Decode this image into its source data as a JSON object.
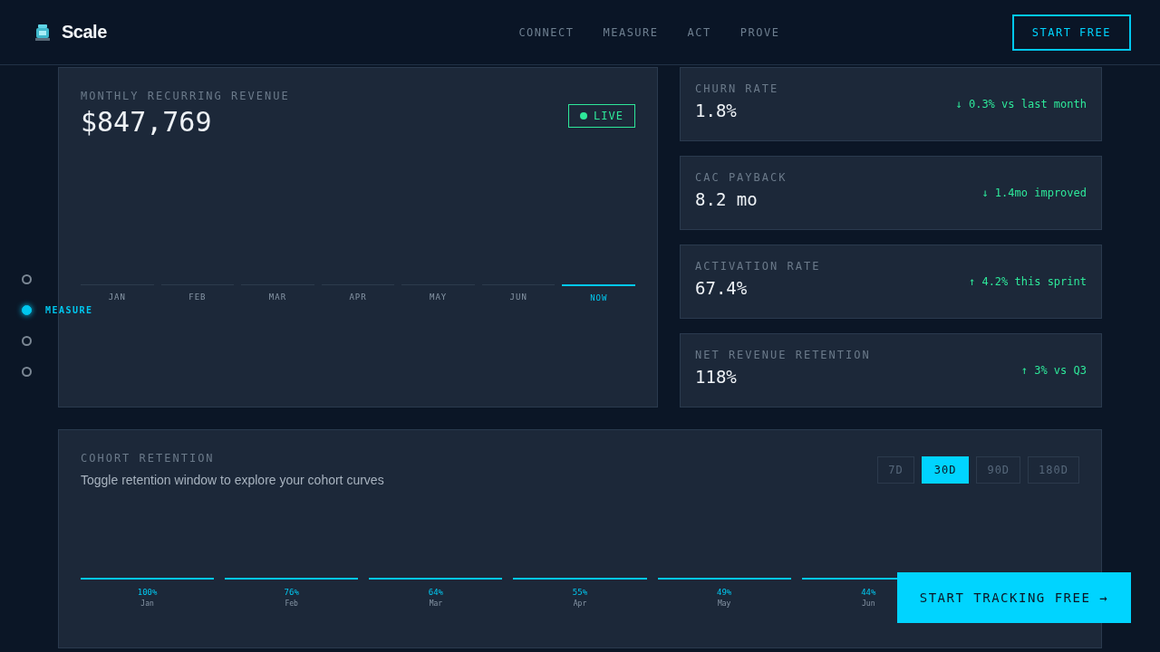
{
  "header": {
    "brand": "Scale",
    "nav": [
      {
        "label": "CONNECT",
        "selected": false
      },
      {
        "label": "MEASURE",
        "selected": false
      },
      {
        "label": "ACT",
        "selected": false
      },
      {
        "label": "PROVE",
        "selected": false
      }
    ],
    "cta": "START FREE"
  },
  "side_nav": [
    {
      "selected": false
    },
    {
      "selected": true,
      "label": "MEASURE"
    },
    {
      "selected": false
    },
    {
      "selected": false
    }
  ],
  "mrr": {
    "title": "MONTHLY RECURRING REVENUE",
    "value": "$847,769",
    "live": "LIVE",
    "months": [
      {
        "label": "JAN",
        "selected": false
      },
      {
        "label": "FEB",
        "selected": false
      },
      {
        "label": "MAR",
        "selected": false
      },
      {
        "label": "APR",
        "selected": false
      },
      {
        "label": "MAY",
        "selected": false
      },
      {
        "label": "JUN",
        "selected": false
      },
      {
        "label": "NOW",
        "selected": true
      }
    ]
  },
  "metrics": [
    {
      "title": "CHURN RATE",
      "value": "1.8%",
      "change": "↓ 0.3% vs last month"
    },
    {
      "title": "CAC PAYBACK",
      "value": "8.2 mo",
      "change": "↓ 1.4mo improved"
    },
    {
      "title": "ACTIVATION RATE",
      "value": "67.4%",
      "change": "↑ 4.2% this sprint"
    },
    {
      "title": "NET REVENUE RETENTION",
      "value": "118%",
      "change": "↑ 3% vs Q3"
    }
  ],
  "cohort": {
    "title": "COHORT RETENTION",
    "subtitle": "Toggle retention window to explore your cohort curves",
    "windows": [
      {
        "label": "7D",
        "selected": false
      },
      {
        "label": "30D",
        "selected": true
      },
      {
        "label": "90D",
        "selected": false
      },
      {
        "label": "180D",
        "selected": false
      }
    ],
    "bars": [
      {
        "value": "100%",
        "month": "Jan"
      },
      {
        "value": "76%",
        "month": "Feb"
      },
      {
        "value": "64%",
        "month": "Mar"
      },
      {
        "value": "55%",
        "month": "Apr"
      },
      {
        "value": "49%",
        "month": "May"
      },
      {
        "value": "44%",
        "month": "Jun"
      }
    ]
  },
  "floating_cta": "START TRACKING FREE →"
}
